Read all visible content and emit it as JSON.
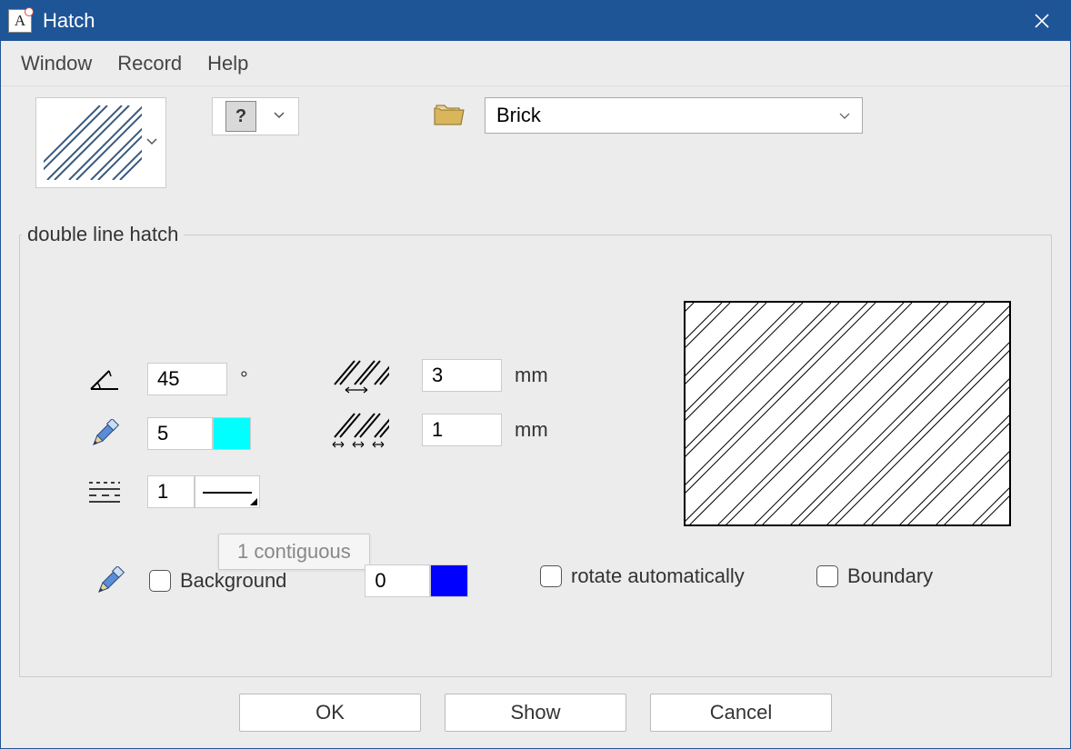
{
  "window": {
    "title": "Hatch"
  },
  "menu": {
    "window": "Window",
    "record": "Record",
    "help": "Help"
  },
  "pattern_select": {
    "value": "Brick"
  },
  "group": {
    "legend": "double line hatch"
  },
  "params": {
    "angle": {
      "value": "45",
      "unit": "°"
    },
    "spacing1": {
      "value": "3",
      "unit": "mm"
    },
    "pen": {
      "value": "5",
      "color": "#00ffff"
    },
    "spacing2": {
      "value": "1",
      "unit": "mm"
    },
    "linestyle": {
      "value": "1"
    }
  },
  "tooltip": "1  contiguous",
  "bg": {
    "label": "Background",
    "value": "0",
    "color": "#0000ff"
  },
  "rotate": {
    "label": "rotate automatically"
  },
  "boundary": {
    "label": "Boundary"
  },
  "buttons": {
    "ok": "OK",
    "show": "Show",
    "cancel": "Cancel"
  }
}
